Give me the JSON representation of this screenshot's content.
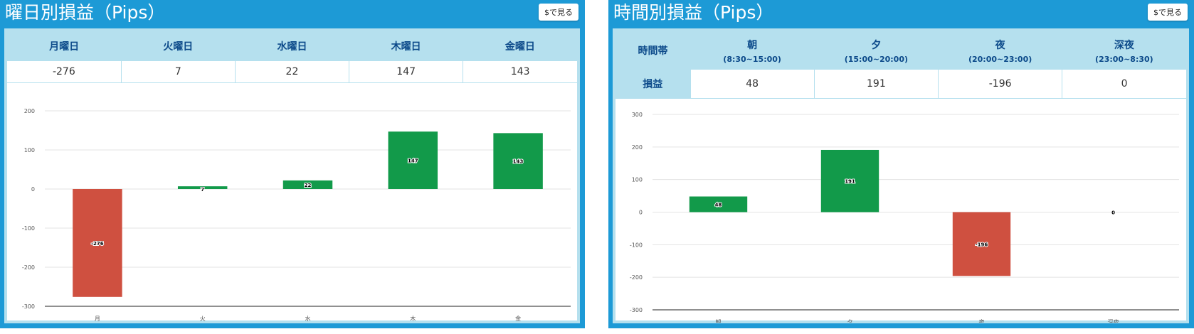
{
  "week_panel": {
    "title": "曜日別損益（Pips）",
    "usd_button": "$で見る",
    "headers": [
      "月曜日",
      "火曜日",
      "水曜日",
      "木曜日",
      "金曜日"
    ],
    "values": [
      "-276",
      "7",
      "22",
      "147",
      "143"
    ]
  },
  "time_panel": {
    "title": "時間別損益（Pips）",
    "usd_button": "$で見る",
    "row_header_period": "時間帯",
    "row_header_pnl": "損益",
    "periods": [
      {
        "name": "朝",
        "hours": "(8:30~15:00)"
      },
      {
        "name": "夕",
        "hours": "(15:00~20:00)"
      },
      {
        "name": "夜",
        "hours": "(20:00~23:00)"
      },
      {
        "name": "深夜",
        "hours": "(23:00~8:30)"
      }
    ],
    "values": [
      "48",
      "191",
      "-196",
      "0"
    ]
  },
  "colors": {
    "positive": "#129a4a",
    "negative": "#cf5040",
    "panel_bg": "#1d9ad6",
    "header_bg": "#b5e0ee"
  },
  "chart_data": [
    {
      "type": "bar",
      "categories": [
        "月",
        "火",
        "水",
        "木",
        "金"
      ],
      "values": [
        -276,
        7,
        22,
        147,
        143
      ],
      "data_labels": [
        "-276",
        "7",
        "22",
        "147",
        "143"
      ],
      "title": "",
      "xlabel": "",
      "ylabel": "",
      "ylim": [
        -300,
        200
      ],
      "yticks": [
        200,
        100,
        0,
        -100,
        -200,
        -300
      ],
      "grid": true
    },
    {
      "type": "bar",
      "categories": [
        "朝",
        "夕",
        "夜",
        "深夜"
      ],
      "values": [
        48,
        191,
        -196,
        0
      ],
      "data_labels": [
        "48",
        "191",
        "-196",
        "0"
      ],
      "title": "",
      "xlabel": "",
      "ylabel": "",
      "ylim": [
        -300,
        300
      ],
      "yticks": [
        300,
        200,
        100,
        0,
        -100,
        -200,
        -300
      ],
      "grid": true
    }
  ]
}
